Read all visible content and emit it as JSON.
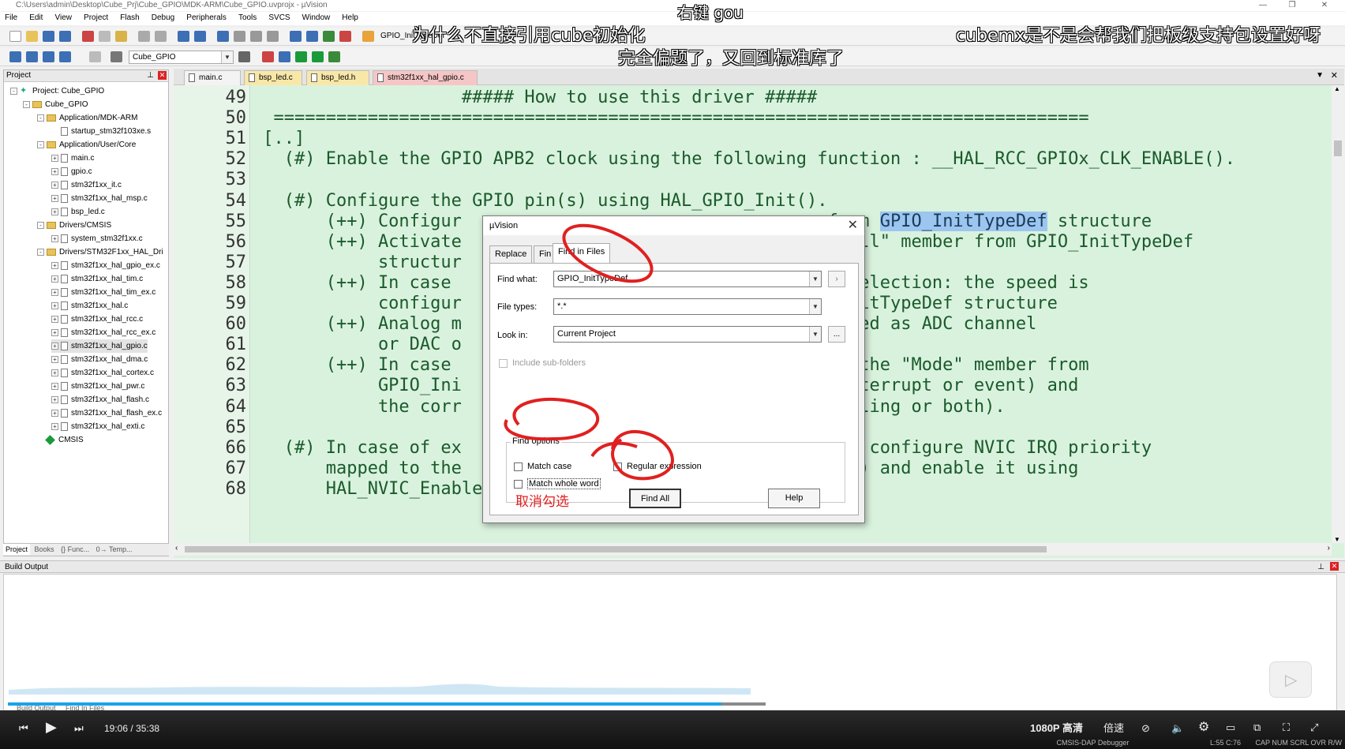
{
  "window": {
    "title": "C:\\Users\\admin\\Desktop\\Cube_Prj\\Cube_GPIO\\MDK-ARM\\Cube_GPIO.uvprojx - µVision"
  },
  "menu": [
    "File",
    "Edit",
    "View",
    "Project",
    "Flash",
    "Debug",
    "Peripherals",
    "Tools",
    "SVCS",
    "Window",
    "Help"
  ],
  "toolbar": {
    "search_value": "GPIO_InitTypeDef",
    "target_value": "Cube_GPIO"
  },
  "project_panel": {
    "title": "Project",
    "tree": [
      {
        "label": "Project: Cube_GPIO",
        "icon": "project-icon",
        "level": 0,
        "expander": "-"
      },
      {
        "label": "Cube_GPIO",
        "icon": "folder-icon",
        "level": 1,
        "expander": "-"
      },
      {
        "label": "Application/MDK-ARM",
        "icon": "folder-icon",
        "level": 2,
        "expander": "-"
      },
      {
        "label": "startup_stm32f103xe.s",
        "icon": "file-icon",
        "level": 3,
        "expander": ""
      },
      {
        "label": "Application/User/Core",
        "icon": "folder-icon",
        "level": 2,
        "expander": "-"
      },
      {
        "label": "main.c",
        "icon": "file-icon",
        "level": 3,
        "expander": "+"
      },
      {
        "label": "gpio.c",
        "icon": "file-icon",
        "level": 3,
        "expander": "+"
      },
      {
        "label": "stm32f1xx_it.c",
        "icon": "file-icon",
        "level": 3,
        "expander": "+"
      },
      {
        "label": "stm32f1xx_hal_msp.c",
        "icon": "file-icon",
        "level": 3,
        "expander": "+"
      },
      {
        "label": "bsp_led.c",
        "icon": "file-icon",
        "level": 3,
        "expander": "+"
      },
      {
        "label": "Drivers/CMSIS",
        "icon": "folder-icon",
        "level": 2,
        "expander": "-"
      },
      {
        "label": "system_stm32f1xx.c",
        "icon": "file-icon",
        "level": 3,
        "expander": "+"
      },
      {
        "label": "Drivers/STM32F1xx_HAL_Dri",
        "icon": "folder-icon",
        "level": 2,
        "expander": "-"
      },
      {
        "label": "stm32f1xx_hal_gpio_ex.c",
        "icon": "file-icon",
        "level": 3,
        "expander": "+"
      },
      {
        "label": "stm32f1xx_hal_tim.c",
        "icon": "file-icon",
        "level": 3,
        "expander": "+"
      },
      {
        "label": "stm32f1xx_hal_tim_ex.c",
        "icon": "file-icon",
        "level": 3,
        "expander": "+"
      },
      {
        "label": "stm32f1xx_hal.c",
        "icon": "file-icon",
        "level": 3,
        "expander": "+"
      },
      {
        "label": "stm32f1xx_hal_rcc.c",
        "icon": "file-icon",
        "level": 3,
        "expander": "+"
      },
      {
        "label": "stm32f1xx_hal_rcc_ex.c",
        "icon": "file-icon",
        "level": 3,
        "expander": "+"
      },
      {
        "label": "stm32f1xx_hal_gpio.c",
        "icon": "file-icon",
        "level": 3,
        "expander": "+"
      },
      {
        "label": "stm32f1xx_hal_dma.c",
        "icon": "file-icon",
        "level": 3,
        "expander": "+"
      },
      {
        "label": "stm32f1xx_hal_cortex.c",
        "icon": "file-icon",
        "level": 3,
        "expander": "+"
      },
      {
        "label": "stm32f1xx_hal_pwr.c",
        "icon": "file-icon",
        "level": 3,
        "expander": "+"
      },
      {
        "label": "stm32f1xx_hal_flash.c",
        "icon": "file-icon",
        "level": 3,
        "expander": "+"
      },
      {
        "label": "stm32f1xx_hal_flash_ex.c",
        "icon": "file-icon",
        "level": 3,
        "expander": "+"
      },
      {
        "label": "stm32f1xx_hal_exti.c",
        "icon": "file-icon",
        "level": 3,
        "expander": "+"
      },
      {
        "label": "CMSIS",
        "icon": "diamond-icon",
        "level": 2,
        "expander": ""
      }
    ],
    "tabs": [
      "Project",
      "Books",
      "{} Func...",
      "0→ Temp..."
    ]
  },
  "editor": {
    "tabs": [
      "main.c",
      "bsp_led.c",
      "bsp_led.h",
      "stm32f1xx_hal_gpio.c"
    ],
    "active_tab": "stm32f1xx_hal_gpio.c",
    "lines": [
      {
        "n": "49",
        "text": "                    ##### How to use this driver #####"
      },
      {
        "n": "50",
        "text": "  =============================================================================="
      },
      {
        "n": "51",
        "text": " [..]"
      },
      {
        "n": "52",
        "text": "   (#) Enable the GPIO APB2 clock using the following function : __HAL_RCC_GPIOx_CLK_ENABLE()."
      },
      {
        "n": "53",
        "text": ""
      },
      {
        "n": "54",
        "text": "   (#) Configure the GPIO pin(s) using HAL_GPIO_Init()."
      },
      {
        "n": "55",
        "text": "       (++) Configur                                   from GPIO_InitTypeDef structure"
      },
      {
        "n": "56",
        "text": "       (++) Activate                                   \"Pull\" member from GPIO_InitTypeDef"
      },
      {
        "n": "57",
        "text": "            structur"
      },
      {
        "n": "58",
        "text": "       (++) In case                                   de selection: the speed is"
      },
      {
        "n": "59",
        "text": "            configur                                  O_InitTypeDef structure"
      },
      {
        "n": "60",
        "text": "       (++) Analog m                                  e used as ADC channel"
      },
      {
        "n": "61",
        "text": "            or DAC o"
      },
      {
        "n": "62",
        "text": "       (++) In case                                   ion the \"Mode\" member from"
      },
      {
        "n": "63",
        "text": "            GPIO_Ini                                   (interrupt or event) and"
      },
      {
        "n": "64",
        "text": "            the corr                                   falling or both)."
      },
      {
        "n": "65",
        "text": ""
      },
      {
        "n": "66",
        "text": "   (#) In case of ex                                  ion, configure NVIC IRQ priority"
      },
      {
        "n": "67",
        "text": "       mapped to the                                  ity() and enable it using"
      },
      {
        "n": "68",
        "text": "       HAL_NVIC_EnableIRQ()."
      }
    ],
    "highlight": "GPIO_InitTypeDef"
  },
  "dialog": {
    "title": "µVision",
    "tabs": [
      "Replace",
      "Fin",
      "Find in Files"
    ],
    "find_what_label": "Find what:",
    "find_what_value": "GPIO_InitTypeDef",
    "file_types_label": "File types:",
    "file_types_value": "*.*",
    "look_in_label": "Look in:",
    "look_in_value": "Current Project",
    "browse_label": "...",
    "include_sub_label": "Include sub-folders",
    "find_options_label": "Find options",
    "match_case_label": "Match case",
    "regex_label": "Regular expression",
    "whole_word_label": "Match whole word",
    "find_all_label": "Find All",
    "help_label": "Help",
    "annotation": "取消勾选"
  },
  "build_output": {
    "title": "Build Output",
    "tabs": [
      "Build Output",
      "Find In Files"
    ]
  },
  "player": {
    "time_current": "19:06",
    "time_total": "35:38",
    "quality": "1080P 高清",
    "speed": "倍速",
    "progress": 0.535
  },
  "statusbar": {
    "debugger": "CMSIS-DAP Debugger",
    "position": "L:55 C:76",
    "flags": "CAP  NUM  SCRL  OVR  R/W"
  },
  "danmaku": [
    "右键 gou",
    "为什么不直接引用cube初始化",
    "cubemx是不是会帮我们把板级支持包设置好呀",
    "完全偏题了，又回到标准库了"
  ],
  "colors": {
    "editor_bg": "#d9f2dd",
    "highlight": "#9cc6f0",
    "annotation_red": "#e02020",
    "progress": "#1aa3e8"
  }
}
